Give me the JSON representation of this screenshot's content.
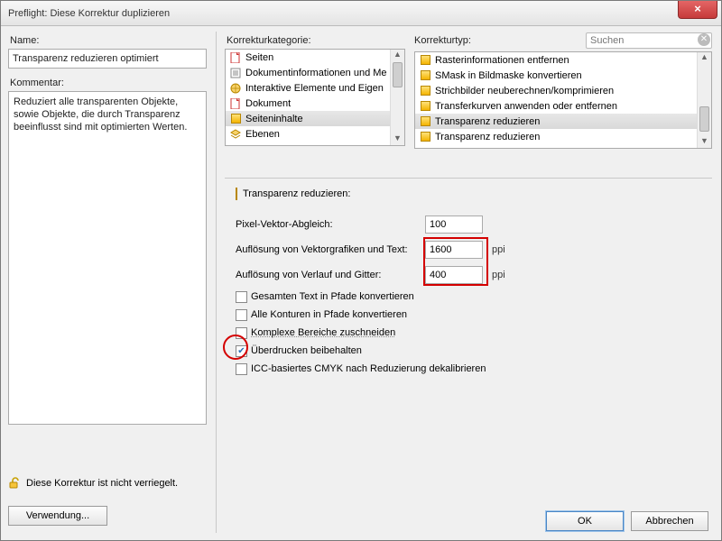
{
  "window": {
    "title": "Preflight: Diese Korrektur duplizieren"
  },
  "left": {
    "name_label": "Name:",
    "name_value": "Transparenz reduzieren optimiert",
    "comment_label": "Kommentar:",
    "comment_value": "Reduziert alle transparenten Objekte, sowie Objekte, die durch Transparenz beeinflusst sind mit optimierten Werten.",
    "lock_text": "Diese Korrektur ist nicht verriegelt.",
    "usage_btn": "Verwendung..."
  },
  "cat": {
    "label": "Korrekturkategorie:",
    "items": [
      {
        "label": "Seiten",
        "icon": "pdf"
      },
      {
        "label": "Dokumentinformationen und Me",
        "icon": "doc"
      },
      {
        "label": "Interaktive Elemente und Eigen",
        "icon": "globe"
      },
      {
        "label": "Dokument",
        "icon": "pdf"
      },
      {
        "label": "Seiteninhalte",
        "icon": "fixup",
        "selected": true
      },
      {
        "label": "Ebenen",
        "icon": "layer"
      }
    ]
  },
  "typ": {
    "label": "Korrekturtyp:",
    "search_placeholder": "Suchen",
    "items": [
      {
        "label": "Rasterinformationen entfernen"
      },
      {
        "label": "SMask in Bildmaske konvertieren"
      },
      {
        "label": "Strichbilder neuberechnen/komprimieren"
      },
      {
        "label": "Transferkurven anwenden oder entfernen"
      },
      {
        "label": "Transparenz reduzieren",
        "selected": true
      },
      {
        "label": "Transparenz reduzieren"
      }
    ]
  },
  "panel": {
    "header": "Transparenz reduzieren:",
    "rows": {
      "pixel_label": "Pixel-Vektor-Abgleich:",
      "pixel_value": "100",
      "vec_label": "Auflösung von Vektorgrafiken und Text:",
      "vec_value": "1600",
      "grad_label": "Auflösung von Verlauf und Gitter:",
      "grad_value": "400",
      "unit": "ppi"
    },
    "checks": {
      "c1": "Gesamten Text in Pfade konvertieren",
      "c2": "Alle Konturen in Pfade konvertieren",
      "c3": "Komplexe Bereiche zuschneiden",
      "c4": "Überdrucken beibehalten",
      "c5": "ICC-basiertes CMYK nach Reduzierung dekalibrieren"
    }
  },
  "buttons": {
    "ok": "OK",
    "cancel": "Abbrechen"
  }
}
